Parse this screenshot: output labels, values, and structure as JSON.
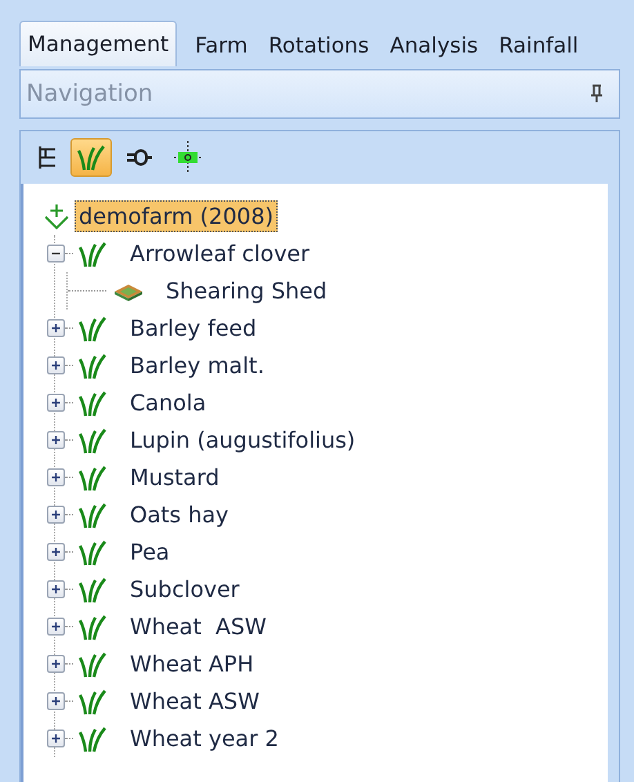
{
  "tabs": [
    {
      "label": "Management",
      "selected": true
    },
    {
      "label": "Farm",
      "selected": false
    },
    {
      "label": "Rotations",
      "selected": false
    },
    {
      "label": "Analysis",
      "selected": false
    },
    {
      "label": "Rainfall",
      "selected": false
    }
  ],
  "navigation": {
    "title": "Navigation",
    "pinned": true
  },
  "toolbar": [
    {
      "kind": "tree",
      "selected": false
    },
    {
      "kind": "crop",
      "selected": true
    },
    {
      "kind": "link",
      "selected": false
    },
    {
      "kind": "target",
      "selected": false
    }
  ],
  "tree": {
    "label": "demofarm (2008)",
    "kind": "farm",
    "selected": true,
    "children": [
      {
        "label": "Arrowleaf clover",
        "kind": "crop",
        "expanded": true,
        "children": [
          {
            "label": "Shearing Shed",
            "kind": "paddock"
          }
        ]
      },
      {
        "label": "Barley feed",
        "kind": "crop",
        "expanded": false
      },
      {
        "label": "Barley malt.",
        "kind": "crop",
        "expanded": false
      },
      {
        "label": "Canola",
        "kind": "crop",
        "expanded": false
      },
      {
        "label": "Lupin (augustifolius)",
        "kind": "crop",
        "expanded": false
      },
      {
        "label": "Mustard",
        "kind": "crop",
        "expanded": false
      },
      {
        "label": "Oats hay",
        "kind": "crop",
        "expanded": false
      },
      {
        "label": "Pea",
        "kind": "crop",
        "expanded": false
      },
      {
        "label": "Subclover",
        "kind": "crop",
        "expanded": false
      },
      {
        "label": "Wheat  ASW",
        "kind": "crop",
        "expanded": false
      },
      {
        "label": "Wheat APH",
        "kind": "crop",
        "expanded": false
      },
      {
        "label": "Wheat ASW",
        "kind": "crop",
        "expanded": false
      },
      {
        "label": "Wheat year 2",
        "kind": "crop",
        "expanded": false
      }
    ]
  }
}
